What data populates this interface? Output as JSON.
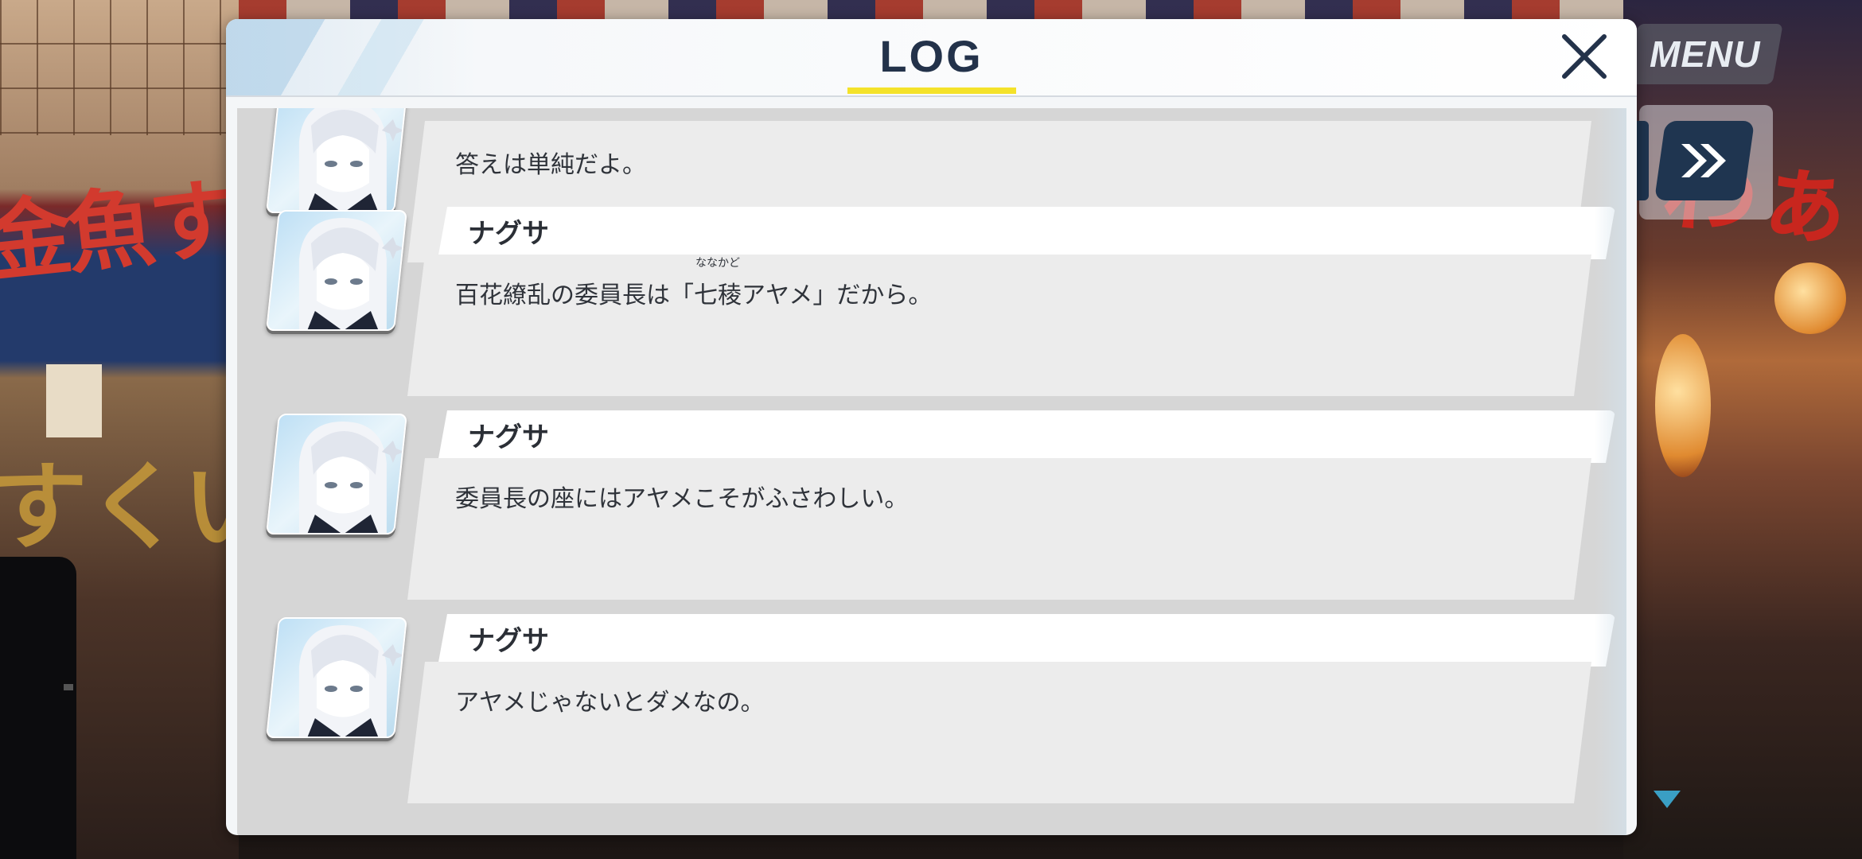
{
  "hud": {
    "menu_label": "MENU"
  },
  "log": {
    "title": "LOG",
    "entries": [
      {
        "speaker": "",
        "message": "答えは単純だよ。"
      },
      {
        "speaker": "ナグサ",
        "message_prefix": "百花繚乱の委員長は「",
        "ruby_base": "七稜",
        "ruby_text": "ななかど",
        "message_suffix": "アヤメ」だから。"
      },
      {
        "speaker": "ナグサ",
        "message": "委員長の座にはアヤメこそがふさわしい。"
      },
      {
        "speaker": "ナグサ",
        "message": "アヤメじゃないとダメなの。"
      }
    ]
  },
  "colors": {
    "accent_yellow": "#f4e22a",
    "title_navy": "#23324a",
    "ff_button": "#1f3550",
    "cursor": "#3a9fc4"
  }
}
